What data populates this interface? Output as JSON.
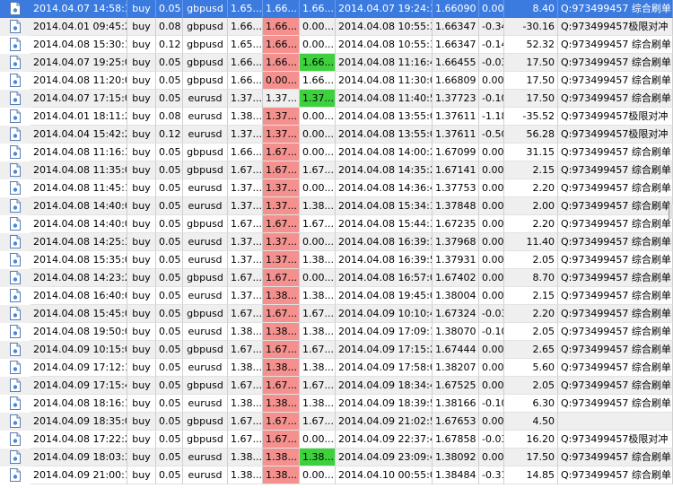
{
  "table": {
    "rows": [
      [
        "2014.04.07 14:58:34",
        "buy",
        "0.05",
        "gbpusd",
        "1.65...",
        "1.66...",
        "1.66...",
        "2014.04.07 19:24:31",
        "1.66090",
        "0.00",
        "8.40",
        "Q:973499457 综合刷单"
      ],
      [
        "2014.04.01 09:45:29",
        "buy",
        "0.08",
        "gbpusd",
        "1.66...",
        "1.66...",
        "0.00...",
        "2014.04.08 10:55:32",
        "1.66347",
        "-0.34",
        "-30.16",
        "Q:973499457极限对冲"
      ],
      [
        "2014.04.08 15:30:17",
        "buy",
        "0.12",
        "gbpusd",
        "1.65...",
        "1.66...",
        "0.00...",
        "2014.04.08 10:55:32",
        "1.66347",
        "-0.14",
        "52.32",
        "Q:973499457 综合刷单"
      ],
      [
        "2014.04.07 19:25:02",
        "buy",
        "0.05",
        "gbpusd",
        "1.66...",
        "1.66...",
        "1.66...",
        "2014.04.08 11:16:47",
        "1.66455",
        "-0.03",
        "17.50",
        "Q:973499457 综合刷单"
      ],
      [
        "2014.04.08 11:20:05",
        "buy",
        "0.05",
        "gbpusd",
        "1.66...",
        "0.00...",
        "1.66...",
        "2014.04.08 11:30:02",
        "1.66809",
        "0.00",
        "17.50",
        "Q:973499457 综合刷单"
      ],
      [
        "2014.04.07 17:15:04",
        "buy",
        "0.05",
        "eurusd",
        "1.37...",
        "1.37...",
        "1.37...",
        "2014.04.08 11:40:58",
        "1.37723",
        "-0.10",
        "17.50",
        "Q:973499457 综合刷单"
      ],
      [
        "2014.04.01 18:11:27",
        "buy",
        "0.08",
        "eurusd",
        "1.38...",
        "1.37...",
        "0.00...",
        "2014.04.08 13:55:00",
        "1.37611",
        "-1.18",
        "-35.52",
        "Q:973499457极限对冲"
      ],
      [
        "2014.04.04 15:42:28",
        "buy",
        "0.12",
        "eurusd",
        "1.37...",
        "1.37...",
        "0.00...",
        "2014.04.08 13:55:00",
        "1.37611",
        "-0.50",
        "56.28",
        "Q:973499457极限对冲"
      ],
      [
        "2014.04.08 11:16:38",
        "buy",
        "0.05",
        "gbpusd",
        "1.66...",
        "1.67...",
        "0.00...",
        "2014.04.08 14:00:26",
        "1.67099",
        "0.00",
        "31.15",
        "Q:973499457 综合刷单"
      ],
      [
        "2014.04.08 11:35:02",
        "buy",
        "0.05",
        "gbpusd",
        "1.67...",
        "1.67...",
        "1.67...",
        "2014.04.08 14:35:23",
        "1.67141",
        "0.00",
        "2.15",
        "Q:973499457 综合刷单"
      ],
      [
        "2014.04.08 11:45:10",
        "buy",
        "0.05",
        "eurusd",
        "1.37...",
        "1.37...",
        "0.00...",
        "2014.04.08 14:36:47",
        "1.37753",
        "0.00",
        "2.20",
        "Q:973499457 综合刷单"
      ],
      [
        "2014.04.08 14:40:03",
        "buy",
        "0.05",
        "eurusd",
        "1.37...",
        "1.37...",
        "1.38...",
        "2014.04.08 15:34:35",
        "1.37848",
        "0.00",
        "2.00",
        "Q:973499457 综合刷单"
      ],
      [
        "2014.04.08 14:40:08",
        "buy",
        "0.05",
        "gbpusd",
        "1.67...",
        "1.67...",
        "1.67...",
        "2014.04.08 15:44:32",
        "1.67235",
        "0.00",
        "2.20",
        "Q:973499457 综合刷单"
      ],
      [
        "2014.04.08 14:25:35",
        "buy",
        "0.05",
        "eurusd",
        "1.37...",
        "1.37...",
        "0.00...",
        "2014.04.08 16:39:16",
        "1.37968",
        "0.00",
        "11.40",
        "Q:973499457 综合刷单"
      ],
      [
        "2014.04.08 15:35:02",
        "buy",
        "0.05",
        "eurusd",
        "1.37...",
        "1.37...",
        "1.38...",
        "2014.04.08 16:39:56",
        "1.37931",
        "0.00",
        "2.05",
        "Q:973499457 综合刷单"
      ],
      [
        "2014.04.08 14:23:28",
        "buy",
        "0.05",
        "gbpusd",
        "1.67...",
        "1.67...",
        "0.00...",
        "2014.04.08 16:57:00",
        "1.67402",
        "0.00",
        "8.70",
        "Q:973499457 综合刷单"
      ],
      [
        "2014.04.08 16:40:03",
        "buy",
        "0.05",
        "eurusd",
        "1.37...",
        "1.38...",
        "1.38...",
        "2014.04.08 19:45:05",
        "1.38004",
        "0.00",
        "2.15",
        "Q:973499457 综合刷单"
      ],
      [
        "2014.04.08 15:45:03",
        "buy",
        "0.05",
        "gbpusd",
        "1.67...",
        "1.67...",
        "1.67...",
        "2014.04.09 10:10:41",
        "1.67324",
        "-0.03",
        "2.20",
        "Q:973499457 综合刷单"
      ],
      [
        "2014.04.08 19:50:02",
        "buy",
        "0.05",
        "eurusd",
        "1.38...",
        "1.38...",
        "1.38...",
        "2014.04.09 17:09:17",
        "1.38070",
        "-0.10",
        "2.05",
        "Q:973499457 综合刷单"
      ],
      [
        "2014.04.09 10:15:03",
        "buy",
        "0.05",
        "gbpusd",
        "1.67...",
        "1.67...",
        "1.67...",
        "2014.04.09 17:15:20",
        "1.67444",
        "0.00",
        "2.65",
        "Q:973499457 综合刷单"
      ],
      [
        "2014.04.09 17:12:17",
        "buy",
        "0.05",
        "eurusd",
        "1.38...",
        "1.38...",
        "1.38...",
        "2014.04.09 17:58:09",
        "1.38207",
        "0.00",
        "5.60",
        "Q:973499457 综合刷单"
      ],
      [
        "2014.04.09 17:15:43",
        "buy",
        "0.05",
        "gbpusd",
        "1.67...",
        "1.67...",
        "1.67...",
        "2014.04.09 18:34:42",
        "1.67525",
        "0.00",
        "2.05",
        "Q:973499457 综合刷单"
      ],
      [
        "2014.04.08 18:16:12",
        "buy",
        "0.05",
        "eurusd",
        "1.38...",
        "1.38...",
        "1.38...",
        "2014.04.09 18:39:56",
        "1.38166",
        "-0.10",
        "6.30",
        "Q:973499457 综合刷单"
      ],
      [
        "2014.04.09 18:35:07",
        "buy",
        "0.05",
        "gbpusd",
        "1.67...",
        "1.67...",
        "1.67...",
        "2014.04.09 21:02:57",
        "1.67653",
        "0.00",
        "4.50",
        ""
      ],
      [
        "2014.04.08 17:22:26",
        "buy",
        "0.05",
        "gbpusd",
        "1.67...",
        "1.67...",
        "0.00...",
        "2014.04.09 22:37:47",
        "1.67858",
        "-0.03",
        "16.20",
        "Q:973499457极限对冲"
      ],
      [
        "2014.04.09 18:03:31",
        "buy",
        "0.05",
        "eurusd",
        "1.38...",
        "1.38...",
        "1.38...",
        "2014.04.09 23:09:47",
        "1.38092",
        "0.00",
        "17.50",
        "Q:973499457 综合刷单"
      ],
      [
        "2014.04.09 21:00:16",
        "buy",
        "0.05",
        "eurusd",
        "1.38...",
        "1.38...",
        "0.00...",
        "2014.04.10 00:55:02",
        "1.38484",
        "-0.31",
        "14.85",
        "Q:973499457 综合刷单"
      ]
    ],
    "sl_highlight": [
      "none",
      "red",
      "red",
      "red",
      "red",
      "none",
      "red",
      "red",
      "red",
      "red",
      "red",
      "red",
      "red",
      "red",
      "red",
      "red",
      "red",
      "red",
      "red",
      "red",
      "red",
      "red",
      "red",
      "red",
      "red",
      "red",
      "red"
    ],
    "tp_highlight": [
      "none",
      "none",
      "none",
      "green",
      "none",
      "green",
      "none",
      "none",
      "none",
      "none",
      "none",
      "none",
      "none",
      "none",
      "none",
      "none",
      "none",
      "none",
      "none",
      "none",
      "none",
      "none",
      "none",
      "none",
      "none",
      "green",
      "none"
    ],
    "selected_row": 0
  },
  "icons": {
    "row_icon": "document-icon"
  },
  "colors": {
    "selected": "#3b7be0",
    "stop_loss_highlight": "#f4918f",
    "take_profit_highlight": "#3ed13e",
    "alt_row": "#efefef"
  }
}
